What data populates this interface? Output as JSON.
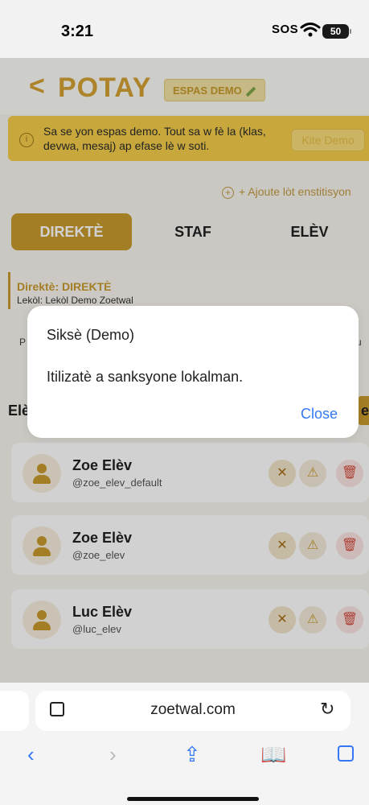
{
  "status": {
    "time": "3:21",
    "sos": "SOS",
    "battery": "50"
  },
  "header": {
    "back": "<",
    "brand": "POTAY",
    "demo_badge": "ESPAS DEMO"
  },
  "banner": {
    "info": "i",
    "text": "Sa se yon espas demo. Tout sa w fè la (klas, devwa, mesaj) ap efase lè w soti.",
    "exit": "Kite Demo"
  },
  "add_institution": "+ Ajoute lòt enstitisyon",
  "tabs": {
    "active": "DIREKTÈ",
    "staf": "STAF",
    "elev": "ELÈV"
  },
  "director": {
    "title": "Direktè: DIREKTÈ",
    "school": "Lekòl: Lekòl Demo Zoetwal"
  },
  "section": {
    "title": "Elè",
    "btn": "e"
  },
  "students": [
    {
      "name": "Zoe Elèv",
      "handle": "@zoe_elev_default"
    },
    {
      "name": "Zoe Elèv",
      "handle": "@zoe_elev"
    },
    {
      "name": "Luc Elèv",
      "handle": "@luc_elev"
    }
  ],
  "dialog": {
    "title": "Siksè (Demo)",
    "message": "Itilizatè a sanksyone lokalman.",
    "close": "Close"
  },
  "safari": {
    "url": "zoetwal.com"
  }
}
